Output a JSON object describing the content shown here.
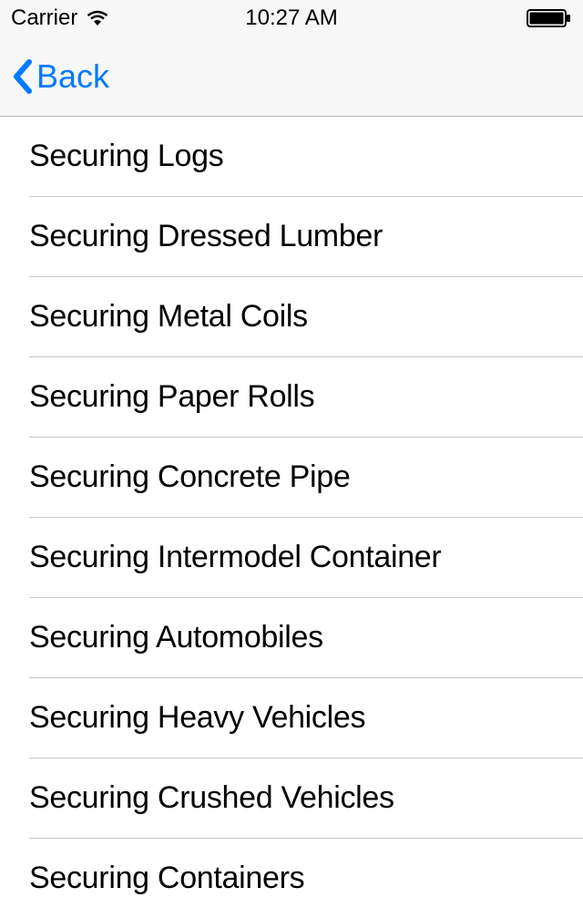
{
  "statusBar": {
    "carrier": "Carrier",
    "time": "10:27 AM"
  },
  "navBar": {
    "backLabel": "Back"
  },
  "list": {
    "items": [
      {
        "label": "Securing Logs"
      },
      {
        "label": "Securing Dressed Lumber"
      },
      {
        "label": "Securing Metal Coils"
      },
      {
        "label": "Securing Paper Rolls"
      },
      {
        "label": "Securing Concrete Pipe"
      },
      {
        "label": "Securing Intermodel Container"
      },
      {
        "label": "Securing Automobiles"
      },
      {
        "label": "Securing Heavy Vehicles"
      },
      {
        "label": "Securing Crushed Vehicles"
      },
      {
        "label": "Securing Containers"
      }
    ]
  }
}
